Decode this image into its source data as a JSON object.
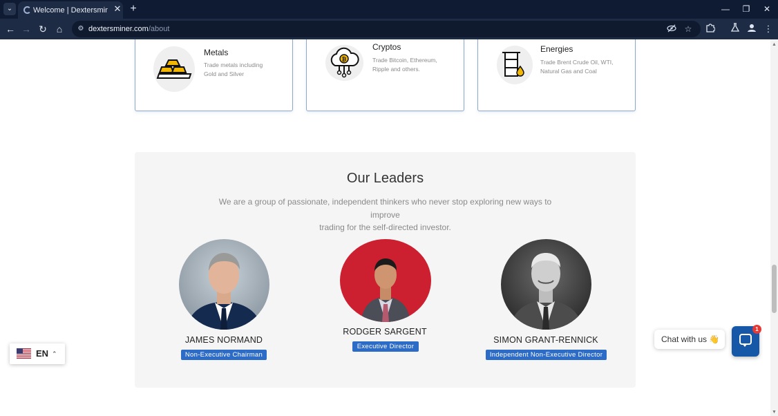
{
  "browser": {
    "tab_title": "Welcome | Dextersminers - Your",
    "tab_menu_icon": "chevron-down-icon",
    "url_host": "dextersminer.com",
    "url_path": "/about",
    "new_tab_symbol": "+",
    "close_symbol": "✕"
  },
  "cards": [
    {
      "title": "Metals",
      "desc_line1": "Trade metals including",
      "desc_line2": "Gold and Silver",
      "icon": "gold-bars-icon"
    },
    {
      "title": "Cryptos",
      "desc_line1": "Trade Bitcoin, Ethereum,",
      "desc_line2": "Ripple and others.",
      "icon": "bitcoin-cloud-icon"
    },
    {
      "title": "Energies",
      "desc_line1": "Trade Brent Crude Oil, WTI,",
      "desc_line2": "Natural Gas and Coal",
      "icon": "oil-barrel-icon"
    }
  ],
  "leaders_section": {
    "title": "Our Leaders",
    "subtitle_line1": "We are a group of passionate, independent thinkers who never stop exploring new ways to improve",
    "subtitle_line2": "trading for the self-directed investor.",
    "leaders": [
      {
        "name": "JAMES NORMAND",
        "role": "Non-Executive Chairman"
      },
      {
        "name": "RODGER SARGENT",
        "role": "Executive Director"
      },
      {
        "name": "SIMON GRANT-RENNICK",
        "role": "Independent Non-Executive Director"
      }
    ]
  },
  "language_selector": {
    "code": "EN",
    "flag": "us-flag-icon"
  },
  "chat": {
    "prompt": "Chat with us",
    "emoji": "👋",
    "unread_count": "1"
  },
  "colors": {
    "badge": "#2c6bc6",
    "chrome_dark": "#0e1b33",
    "chat_launcher": "#1757a8"
  }
}
